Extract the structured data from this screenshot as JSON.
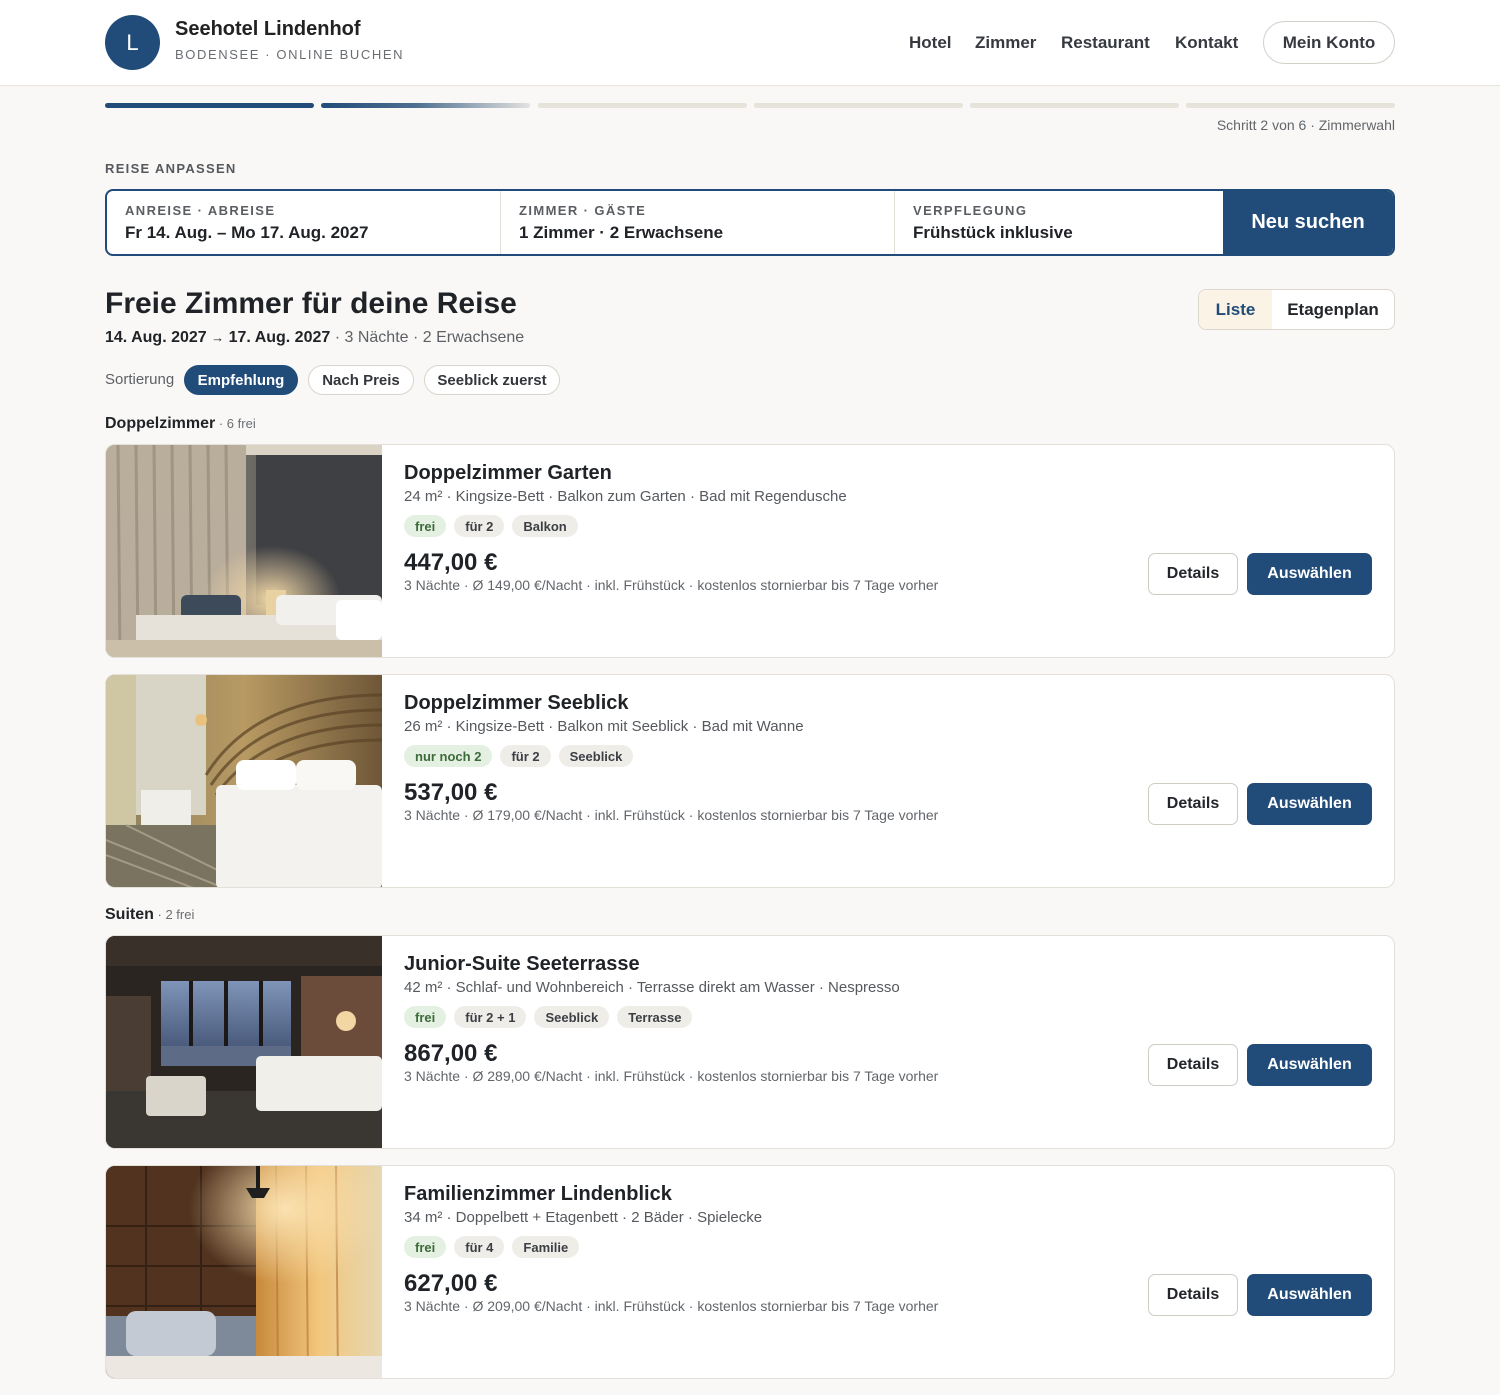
{
  "header": {
    "logo_letter": "L",
    "hotel_name": "Seehotel Lindenhof",
    "hotel_sub": "BODENSEE · ONLINE BUCHEN",
    "nav": [
      "Hotel",
      "Zimmer",
      "Restaurant",
      "Kontakt"
    ],
    "account": "Mein Konto"
  },
  "progress": {
    "steps_total": 6,
    "current_step": 2,
    "label": "Schritt 2 von 6 · Zimmerwahl"
  },
  "search": {
    "section_label": "REISE ANPASSEN",
    "dates_label": "ANREISE · ABREISE",
    "dates_value": "Fr 14. Aug. – Mo 17. Aug. 2027",
    "rooms_label": "ZIMMER · GÄSTE",
    "rooms_value": "1 Zimmer · 2 Erwachsene",
    "board_label": "VERPFLEGUNG",
    "board_value": "Frühstück inklusive",
    "button": "Neu suchen"
  },
  "results": {
    "title": "Freie Zimmer für deine Reise",
    "date_from": "14. Aug. 2027",
    "arrow": "→",
    "date_to": "17. Aug. 2027",
    "summary": " · 3 Nächte · 2 Erwachsene",
    "view_list": "Liste",
    "view_floor": "Etagenplan",
    "sort_label": "Sortierung",
    "sort_options": [
      "Empfehlung",
      "Nach Preis",
      "Seeblick zuerst"
    ]
  },
  "groups": [
    {
      "name": "Doppelzimmer",
      "count": " · 6 frei"
    },
    {
      "name": "Suiten",
      "count": " · 2 frei"
    }
  ],
  "rooms": [
    {
      "name": "Doppelzimmer Garten",
      "desc": "24 m² · Kingsize-Bett · Balkon zum Garten · Bad mit Regendusche",
      "tags": [
        "frei",
        "für 2",
        "Balkon"
      ],
      "price": "447,00 €",
      "note": "3 Nächte · Ø 149,00 €/Nacht · inkl. Frühstück · kostenlos stornierbar bis 7 Tage vorher",
      "details": "Details",
      "select": "Auswählen"
    },
    {
      "name": "Doppelzimmer Seeblick",
      "desc": "26 m² · Kingsize-Bett · Balkon mit Seeblick · Bad mit Wanne",
      "tags": [
        "nur noch 2",
        "für 2",
        "Seeblick"
      ],
      "price": "537,00 €",
      "note": "3 Nächte · Ø 179,00 €/Nacht · inkl. Frühstück · kostenlos stornierbar bis 7 Tage vorher",
      "details": "Details",
      "select": "Auswählen"
    },
    {
      "name": "Junior-Suite Seeterrasse",
      "desc": "42 m² · Schlaf- und Wohnbereich · Terrasse direkt am Wasser · Nespresso",
      "tags": [
        "frei",
        "für 2 + 1",
        "Seeblick",
        "Terrasse"
      ],
      "price": "867,00 €",
      "note": "3 Nächte · Ø 289,00 €/Nacht · inkl. Frühstück · kostenlos stornierbar bis 7 Tage vorher",
      "details": "Details",
      "select": "Auswählen"
    },
    {
      "name": "Familienzimmer Lindenblick",
      "desc": "34 m² · Doppelbett + Etagenbett · 2 Bäder · Spielecke",
      "tags": [
        "frei",
        "für 4",
        "Familie"
      ],
      "price": "627,00 €",
      "note": "3 Nächte · Ø 209,00 €/Nacht · inkl. Frühstück · kostenlos stornierbar bis 7 Tage vorher",
      "details": "Details",
      "select": "Auswählen"
    }
  ]
}
